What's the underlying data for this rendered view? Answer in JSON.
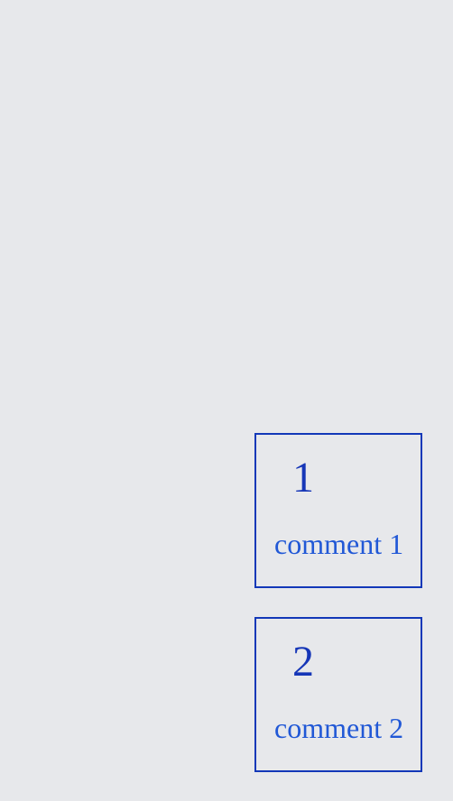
{
  "comments": [
    {
      "number": "1",
      "text": "comment 1"
    },
    {
      "number": "2",
      "text": "comment 2"
    }
  ],
  "colors": {
    "background": "#e7e8eb",
    "border": "#1338b8",
    "number": "#1636b7",
    "text": "#2158d6"
  }
}
